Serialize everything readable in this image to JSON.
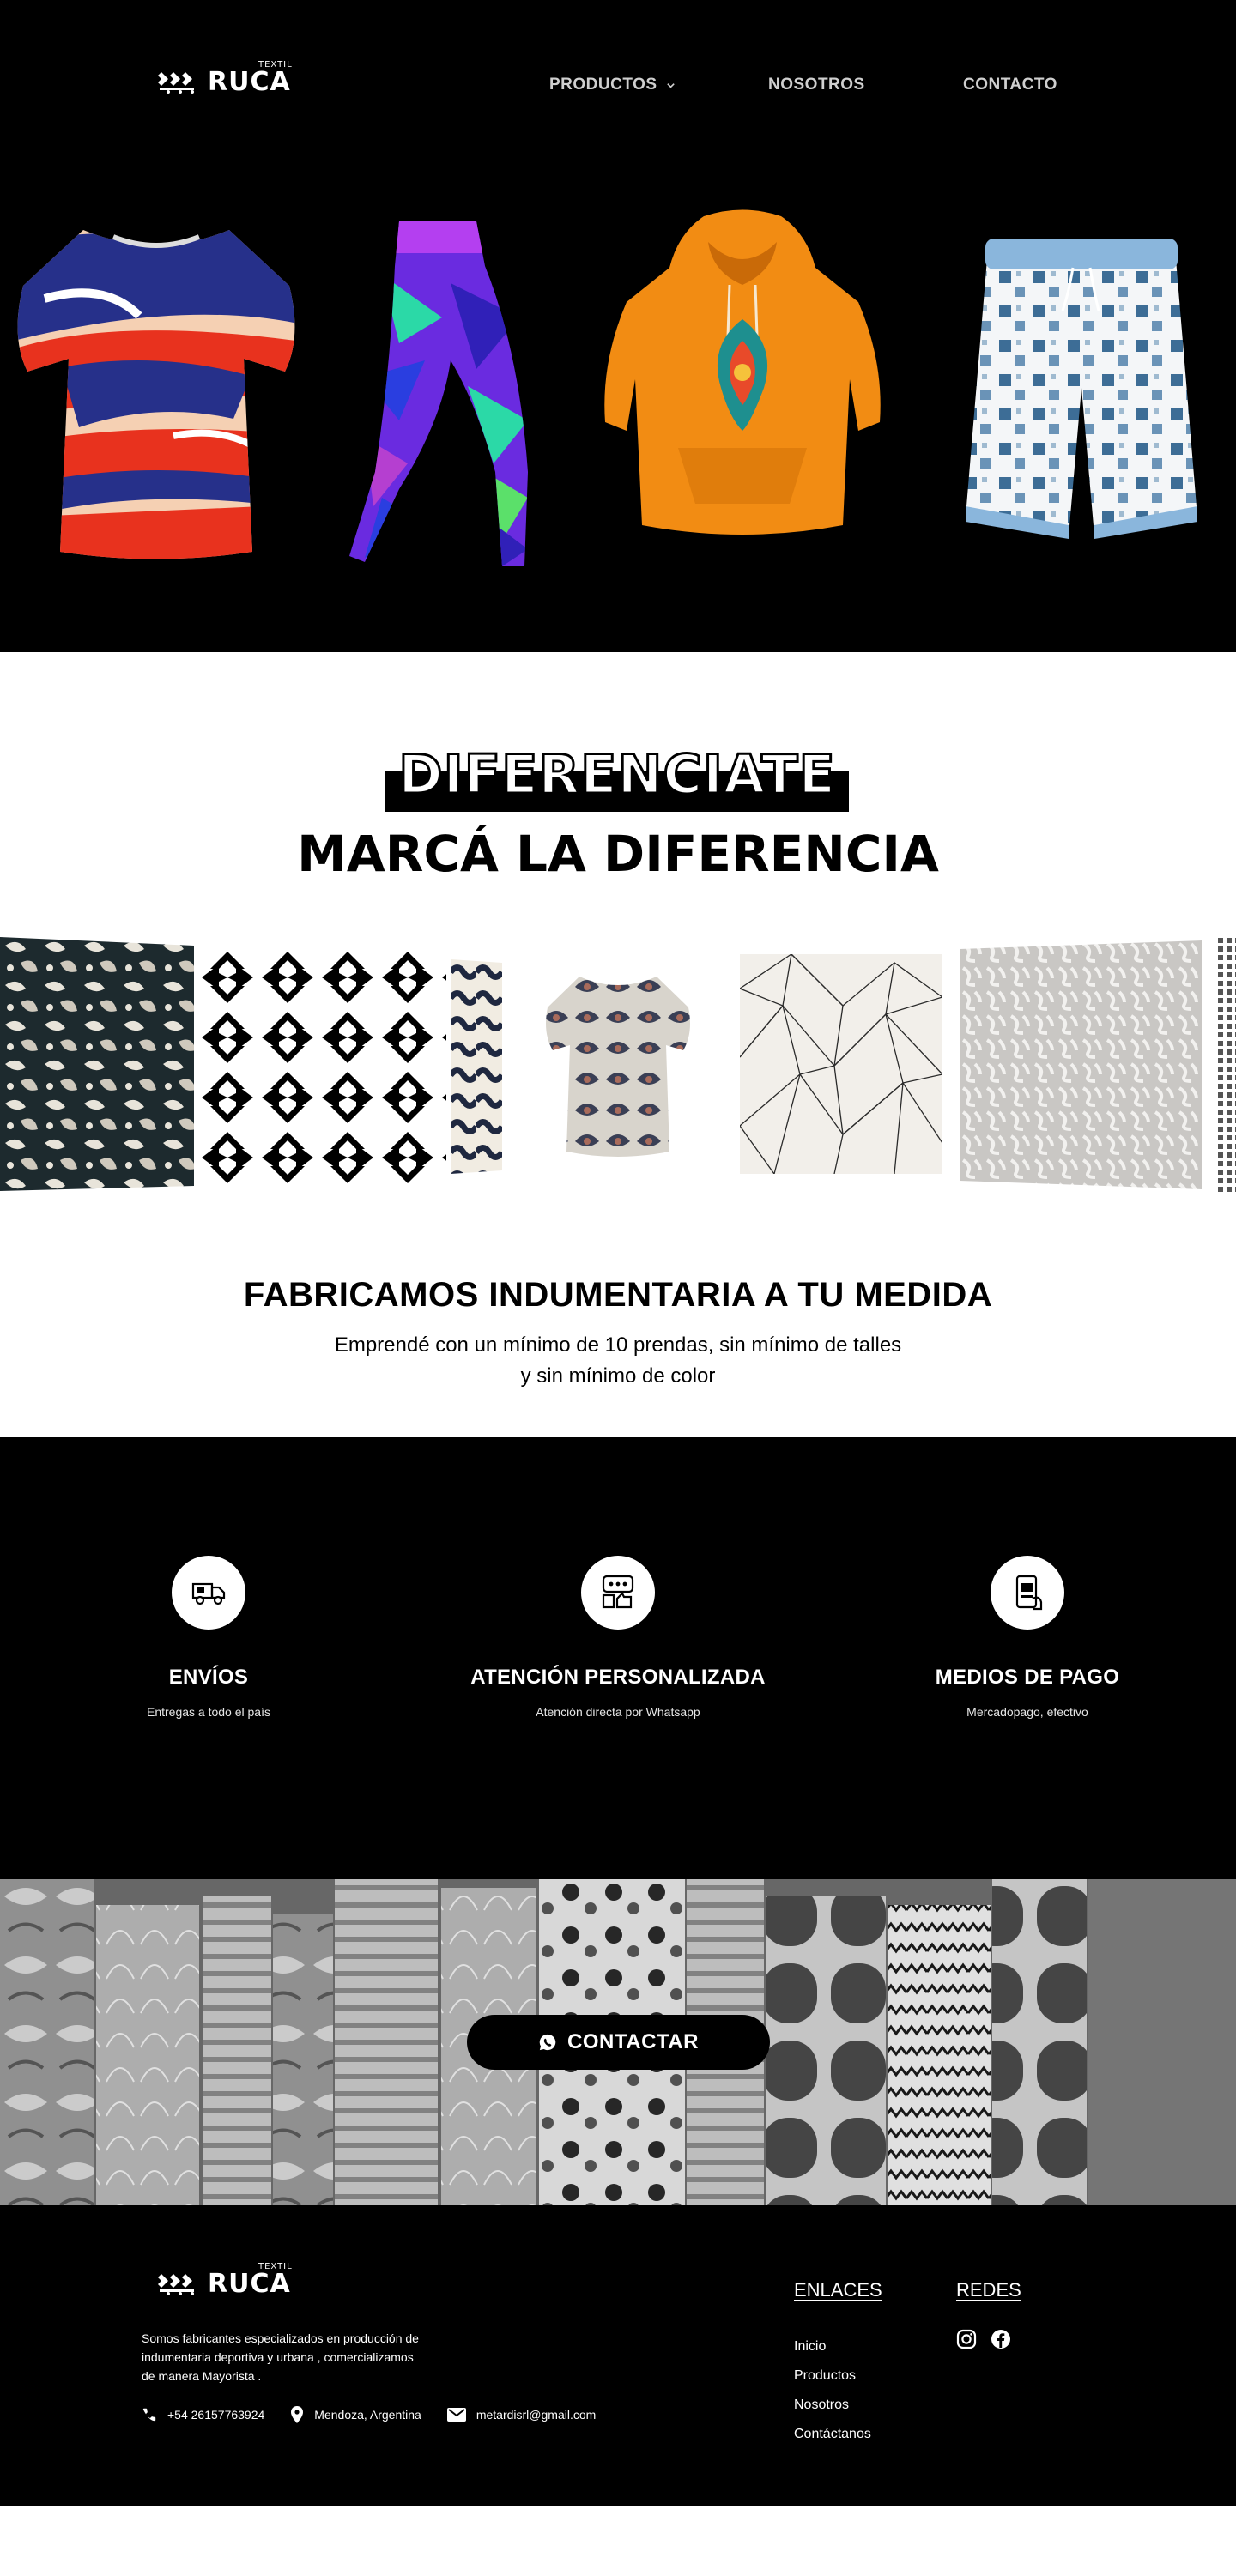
{
  "brand": {
    "name": "RUCA",
    "tag": "TEXTIL"
  },
  "nav": {
    "items": [
      {
        "label": "PRODUCTOS",
        "has_dropdown": true
      },
      {
        "label": "NOSOTROS"
      },
      {
        "label": "CONTACTO"
      }
    ]
  },
  "hero": {
    "products": [
      "t-shirt",
      "leggings",
      "hoodie",
      "shorts"
    ]
  },
  "diferenciate": {
    "outline_title": "DIFERENCIATE",
    "title": "MARCÁ LA DIFERENCIA"
  },
  "fabricamos": {
    "title": "FABRICAMOS INDUMENTARIA A TU MEDIDA",
    "line1": "Emprendé con un mínimo de 10 prendas, sin mínimo de talles",
    "line2": "y sin mínimo de color"
  },
  "features": [
    {
      "icon": "truck-icon",
      "title": "ENVÍOS",
      "subtitle": "Entregas a todo el país"
    },
    {
      "icon": "chat-support-icon",
      "title": "ATENCIÓN PERSONALIZADA",
      "subtitle": "Atención directa por Whatsapp"
    },
    {
      "icon": "phone-payment-icon",
      "title": "MEDIOS DE PAGO",
      "subtitle": "Mercadopago, efectivo"
    }
  ],
  "cta": {
    "label": "CONTACTAR",
    "icon": "whatsapp-icon"
  },
  "footer": {
    "about_lines": [
      "Somos fabricantes especializados en producción de",
      "indumentaria deportiva y urbana , comercializamos",
      "de manera Mayorista ."
    ],
    "phone": "+54 26157763924",
    "location": "Mendoza, Argentina",
    "email": "metardisrl@gmail.com",
    "links_title": "ENLACES",
    "links": [
      "Inicio",
      "Productos",
      "Nosotros",
      "Contáctanos"
    ],
    "social_title": "REDES",
    "social": [
      "instagram-icon",
      "facebook-icon"
    ]
  },
  "colors": {
    "background_dark": "#000000",
    "background_light": "#ffffff",
    "nav_text": "#cfcfcf",
    "hoodie": "#f28c13",
    "tshirt_blue": "#26308a",
    "tshirt_red": "#e8321e"
  }
}
